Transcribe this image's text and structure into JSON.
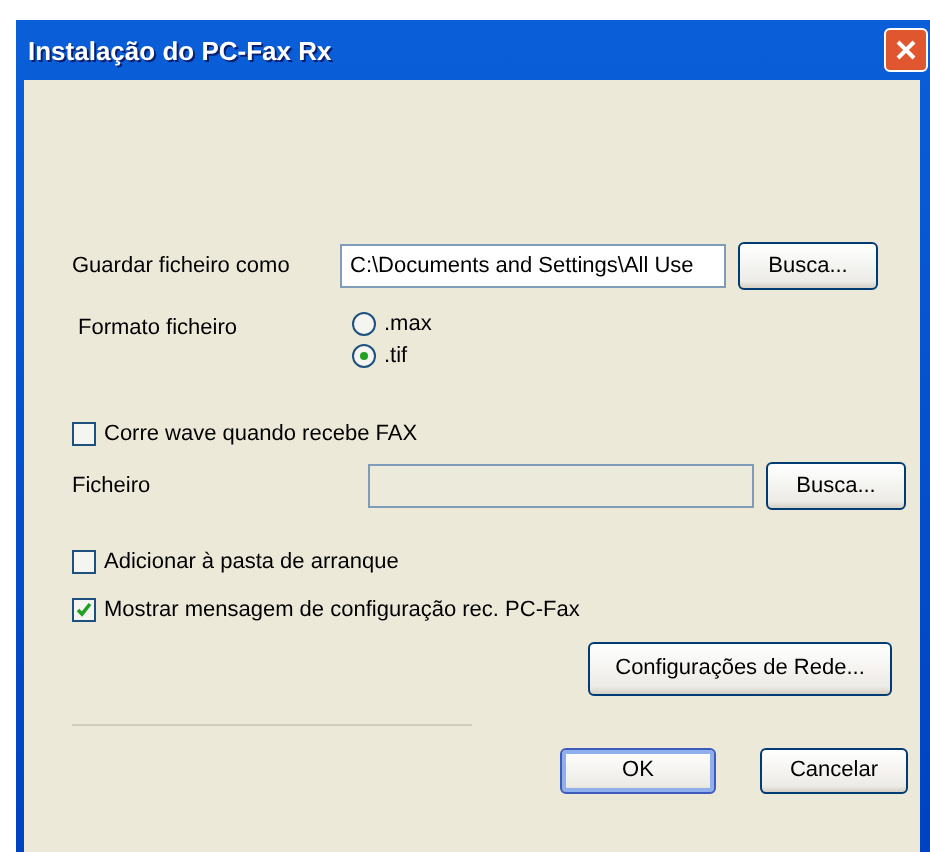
{
  "window": {
    "title": "Instalação do PC-Fax Rx"
  },
  "save_as": {
    "label": "Guardar ficheiro como",
    "value": "C:\\Documents and Settings\\All Use",
    "button": "Busca..."
  },
  "file_format": {
    "label": "Formato ficheiro",
    "options": [
      {
        "label": ".max",
        "selected": false
      },
      {
        "label": ".tif",
        "selected": true
      }
    ]
  },
  "play_wave": {
    "label": "Corre wave quando recebe FAX",
    "checked": false
  },
  "wave_file": {
    "label": "Ficheiro",
    "disabled": true,
    "button": "Busca..."
  },
  "options": [
    {
      "label": "Adicionar à pasta de arranque",
      "checked": false
    },
    {
      "label": "Mostrar mensagem de configuração rec. PC-Fax",
      "checked": true
    }
  ],
  "network_button": "Configurações de Rede...",
  "buttons": [
    {
      "label": "OK",
      "default": true
    },
    {
      "label": "Cancelar",
      "default": false
    }
  ]
}
